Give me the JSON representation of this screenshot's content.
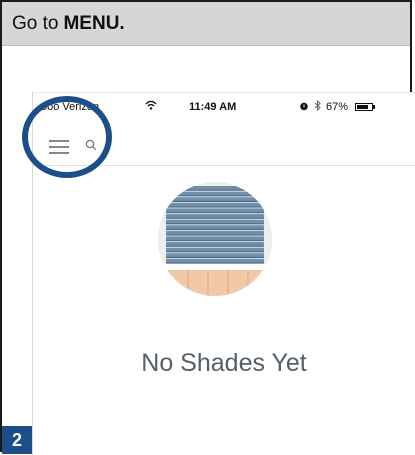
{
  "instruction": {
    "prefix": "Go to",
    "emphasis": "MENU."
  },
  "status_bar": {
    "carrier": "ooo Verizon",
    "time": "11:49 AM",
    "battery": "67%",
    "battery_level": 0.67
  },
  "main": {
    "empty_message": "No Shades Yet"
  },
  "step": {
    "number": "2"
  },
  "colors": {
    "highlight": "#1c4f8a",
    "instruction_bg": "#d6d6d6",
    "blind_slat": "#6f8fab",
    "blind_dark": "#4f6e8a",
    "wood_floor": "#f2c9a6",
    "text_muted": "#555f66"
  },
  "icons": {
    "menu": "hamburger-icon",
    "search": "search-icon",
    "wifi": "wifi-icon",
    "alarm": "alarm-icon",
    "bluetooth": "bluetooth-icon",
    "battery": "battery-icon"
  }
}
